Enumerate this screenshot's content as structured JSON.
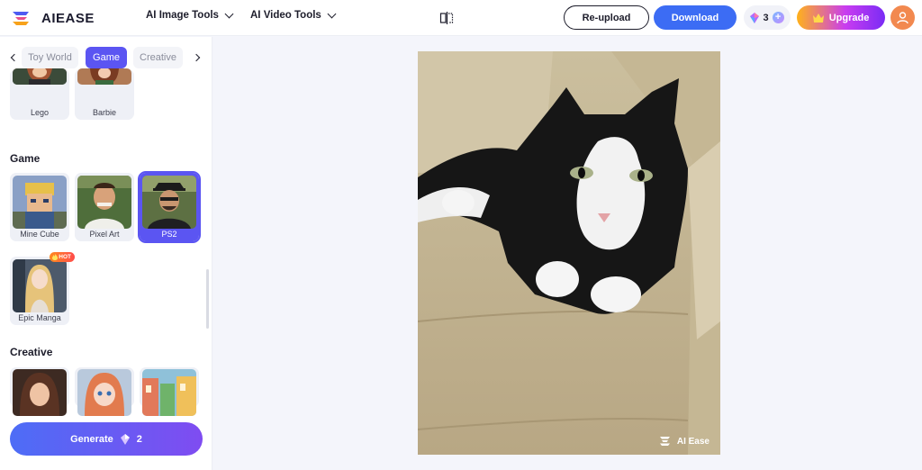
{
  "brand": {
    "name": "AIEASE"
  },
  "nav": [
    {
      "label": "AI Image Tools"
    },
    {
      "label": "AI Video Tools"
    }
  ],
  "toolbar": {
    "reupload_label": "Re-upload",
    "download_label": "Download",
    "credits_count": "3",
    "upgrade_label": "Upgrade"
  },
  "tabs": [
    {
      "label": "Toy World",
      "active": false
    },
    {
      "label": "Game",
      "active": true
    },
    {
      "label": "Creative",
      "active": false
    }
  ],
  "sections": {
    "toy_world_items": [
      {
        "label": "Lego"
      },
      {
        "label": "Barbie"
      }
    ],
    "game": {
      "title": "Game",
      "items": [
        {
          "label": "Mine Cube"
        },
        {
          "label": "Pixel Art"
        },
        {
          "label": "PS2",
          "selected": true
        },
        {
          "label": "Epic Manga",
          "badge": "HOT"
        }
      ]
    },
    "creative": {
      "title": "Creative"
    }
  },
  "generate": {
    "label": "Generate",
    "cost": "2"
  },
  "preview": {
    "watermark": "AI Ease"
  },
  "colors": {
    "accent": "#5b55f2",
    "download": "#3c6cf4",
    "avatar": "#f2894f",
    "canvas_bg": "#f4f5fb"
  }
}
